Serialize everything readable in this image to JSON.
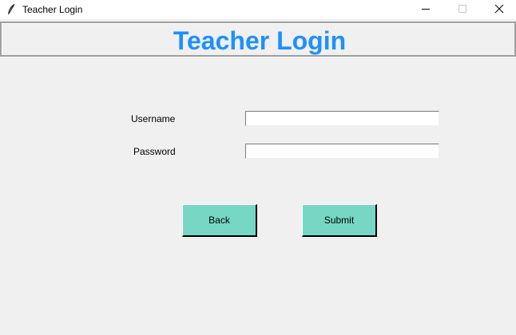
{
  "window": {
    "title": "Teacher Login",
    "icon": "feather-icon"
  },
  "header": {
    "title": "Teacher Login",
    "color": "#1e90ff"
  },
  "form": {
    "username_label": "Username",
    "username_value": "",
    "password_label": "Password",
    "password_value": ""
  },
  "buttons": {
    "back_label": "Back",
    "submit_label": "Submit",
    "color": "#76d7c4"
  }
}
